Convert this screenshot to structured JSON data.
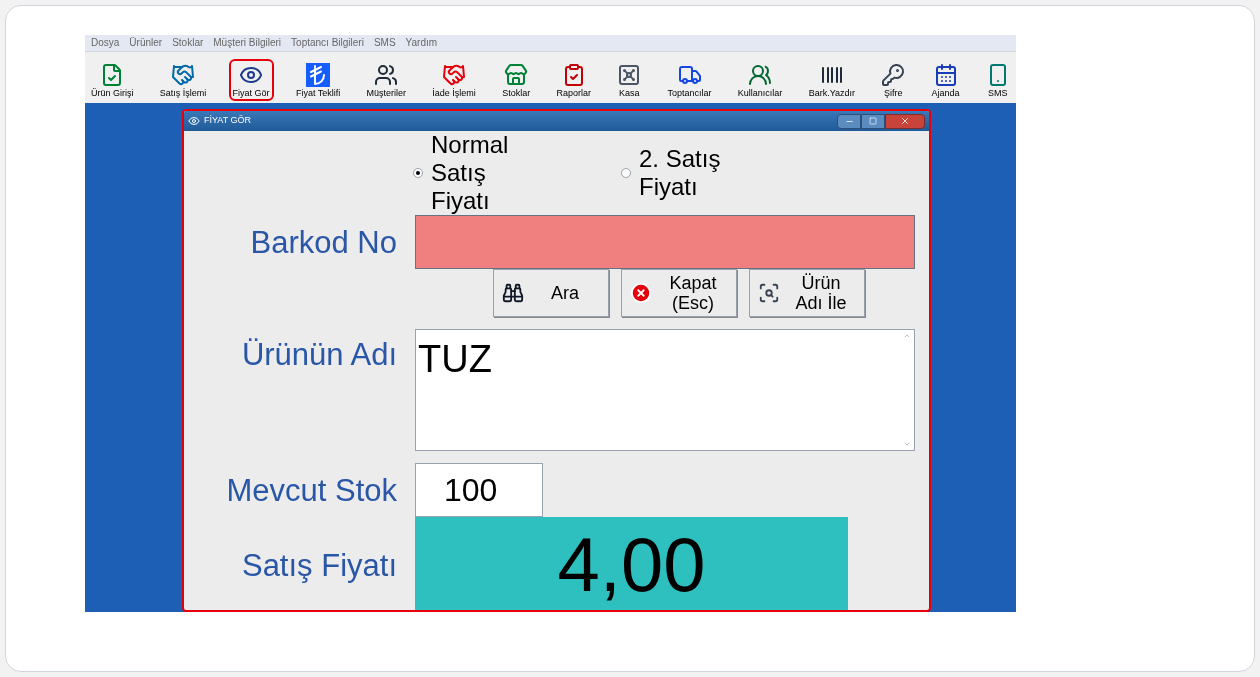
{
  "menu": [
    "Dosya",
    "Ürünler",
    "Stoklar",
    "Müşteri Bilgileri",
    "Toptancı Bilgileri",
    "SMS",
    "Yardım"
  ],
  "toolbar": [
    {
      "label": "Ürün Girişi",
      "selected": false
    },
    {
      "label": "Satış İşlemi",
      "selected": false
    },
    {
      "label": "Fiyat Gör",
      "selected": true
    },
    {
      "label": "Fiyat Teklifi",
      "selected": false
    },
    {
      "label": "Müşteriler",
      "selected": false
    },
    {
      "label": "İade İşlemi",
      "selected": false
    },
    {
      "label": "Stoklar",
      "selected": false
    },
    {
      "label": "Raporlar",
      "selected": false
    },
    {
      "label": "Kasa",
      "selected": false
    },
    {
      "label": "Toptancılar",
      "selected": false
    },
    {
      "label": "Kullanıcılar",
      "selected": false
    },
    {
      "label": "Bark.Yazdır",
      "selected": false
    },
    {
      "label": "Şifre",
      "selected": false
    },
    {
      "label": "Ajanda",
      "selected": false
    },
    {
      "label": "SMS",
      "selected": false
    }
  ],
  "dialog": {
    "title": "FİYAT GÖR",
    "price_options": [
      {
        "label": "Normal Satış Fiyatı",
        "selected": true
      },
      {
        "label": "2. Satış Fiyatı",
        "selected": false
      }
    ],
    "barcode_label": "Barkod No",
    "buttons": [
      {
        "lines": [
          "Ara"
        ]
      },
      {
        "lines": [
          "Kapat",
          "(Esc)"
        ]
      },
      {
        "lines": [
          "Ürün",
          "Adı İle"
        ]
      }
    ],
    "product_name": {
      "label": "Ürünün Adı",
      "value": "TUZ"
    },
    "stock": {
      "label": "Mevcut Stok",
      "value": "100"
    },
    "price": {
      "label": "Satış Fiyatı",
      "value": "4,00"
    }
  }
}
